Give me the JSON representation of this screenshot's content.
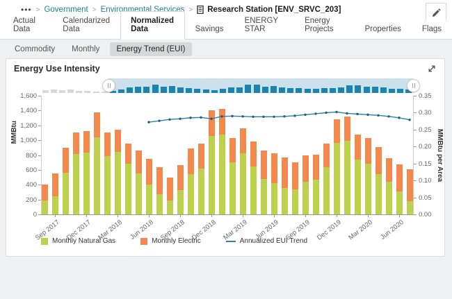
{
  "header": {
    "breadcrumb": {
      "menu_ellipsis": "•••",
      "separator": ">",
      "links": [
        "Government",
        "Environmental Services"
      ],
      "current": "Research Station [ENV_SRVC_203]"
    },
    "edit_icon": "pencil-icon"
  },
  "tabs": [
    "Actual Data",
    "Calendarized Data",
    "Normalized Data",
    "Savings",
    "ENERGY STAR",
    "Energy Projects",
    "Properties",
    "Flags"
  ],
  "active_tab": "Normalized Data",
  "subtabs": [
    "Commodity",
    "Monthly",
    "Energy Trend (EUI)"
  ],
  "active_subtab": "Energy Trend (EUI)",
  "panel": {
    "title": "Energy Use Intensity",
    "expand_icon": "expand-icon"
  },
  "chart_data": {
    "type": "bar",
    "subtype": "stacked columns + line on secondary axis, with range navigator",
    "months": [
      "Aug 2017",
      "Sep 2017",
      "Oct 2017",
      "Nov 2017",
      "Dec 2017",
      "Jan 2018",
      "Feb 2018",
      "Mar 2018",
      "Apr 2018",
      "May 2018",
      "Jun 2018",
      "Jul 2018",
      "Aug 2018",
      "Sep 2018",
      "Oct 2018",
      "Nov 2018",
      "Dec 2018",
      "Jan 2019",
      "Feb 2019",
      "Mar 2019",
      "Apr 2019",
      "May 2019",
      "Jun 2019",
      "Jul 2019",
      "Aug 2019",
      "Sep 2019",
      "Oct 2019",
      "Nov 2019",
      "Dec 2019",
      "Jan 2020",
      "Feb 2020",
      "Mar 2020",
      "Apr 2020",
      "May 2020",
      "Jun 2020",
      "Jul 2020"
    ],
    "x_tick_labels": [
      "Sep 2017",
      "Dec 2017",
      "Mar 2018",
      "Jun 2018",
      "Sep 2018",
      "Dec 2018",
      "Mar 2019",
      "Jun 2019",
      "Sep 2019",
      "Dec 2019",
      "Mar 2020",
      "Jun 2020"
    ],
    "left_axis": {
      "title": "MMBtu",
      "min": 0,
      "max": 1600,
      "step": 200,
      "labels": [
        "0",
        "200",
        "400",
        "600",
        "800",
        "1,000",
        "1,200",
        "1,400",
        "1,600"
      ]
    },
    "right_axis": {
      "title": "MMBtu per Area",
      "min": 0,
      "max": 0.35,
      "step": 0.05,
      "labels": [
        "0.00",
        "0.05",
        "0.10",
        "0.15",
        "0.20",
        "0.25",
        "0.30",
        "0.35"
      ]
    },
    "series": [
      {
        "name": "Monthly Natural Gas",
        "type": "column",
        "stack": "energy",
        "color": "#bdd14c",
        "values": [
          190,
          245,
          560,
          810,
          835,
          1040,
          785,
          840,
          680,
          555,
          405,
          275,
          190,
          330,
          540,
          620,
          1055,
          1080,
          705,
          820,
          650,
          480,
          420,
          360,
          340,
          440,
          465,
          640,
          960,
          990,
          735,
          680,
          545,
          440,
          305,
          180
        ]
      },
      {
        "name": "Monthly Electric",
        "type": "column",
        "stack": "energy",
        "color": "#f5884d",
        "values": [
          215,
          305,
          340,
          290,
          290,
          340,
          315,
          305,
          270,
          305,
          340,
          360,
          305,
          330,
          350,
          335,
          345,
          340,
          325,
          340,
          330,
          385,
          400,
          410,
          365,
          360,
          340,
          310,
          325,
          330,
          345,
          350,
          365,
          315,
          365,
          430
        ]
      },
      {
        "name": "Annualized EUI Trend",
        "type": "line",
        "axis": "right",
        "color": "#2e80a1",
        "marker_color": "#1d6180",
        "start_index": 10,
        "values": [
          0.272,
          0.276,
          0.28,
          0.282,
          0.285,
          0.286,
          0.282,
          0.289,
          0.29,
          0.289,
          0.288,
          0.288,
          0.288,
          0.289,
          0.291,
          0.294,
          0.297,
          0.3,
          0.302,
          0.298,
          0.296,
          0.294,
          0.292,
          0.289,
          0.285,
          0.279
        ]
      }
    ],
    "legend": [
      "Monthly Natural Gas",
      "Monthly Electric",
      "Annualized EUI Trend"
    ],
    "legend_position": "bottom",
    "grid": false,
    "navigator": {
      "leading_values": [
        440,
        545,
        470,
        620,
        360,
        330,
        220,
        220
      ],
      "leading_bar_color": "#d8d8d8",
      "bar_color": "#1b84ad",
      "window_color": "#cde1ec",
      "selected_range": "Aug 2017 – Jul 2020"
    }
  }
}
